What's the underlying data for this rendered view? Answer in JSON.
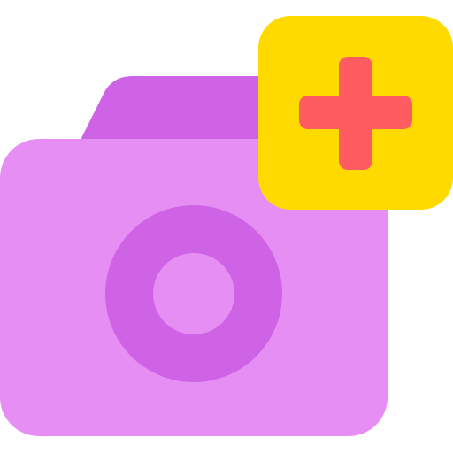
{
  "icon": {
    "name": "add-photo-folder-icon",
    "parts": {
      "folder": "folder-icon",
      "camera_lens": "camera-lens-icon",
      "badge": "add-badge",
      "plus": "plus-icon"
    },
    "colors": {
      "folder_tab": "#CE63E6",
      "folder_body": "#E78EF5",
      "lens_ring": "#CE63E6",
      "lens_center": "#E78EF5",
      "badge_bg": "#FFDA00",
      "plus": "#FF5C61"
    }
  }
}
